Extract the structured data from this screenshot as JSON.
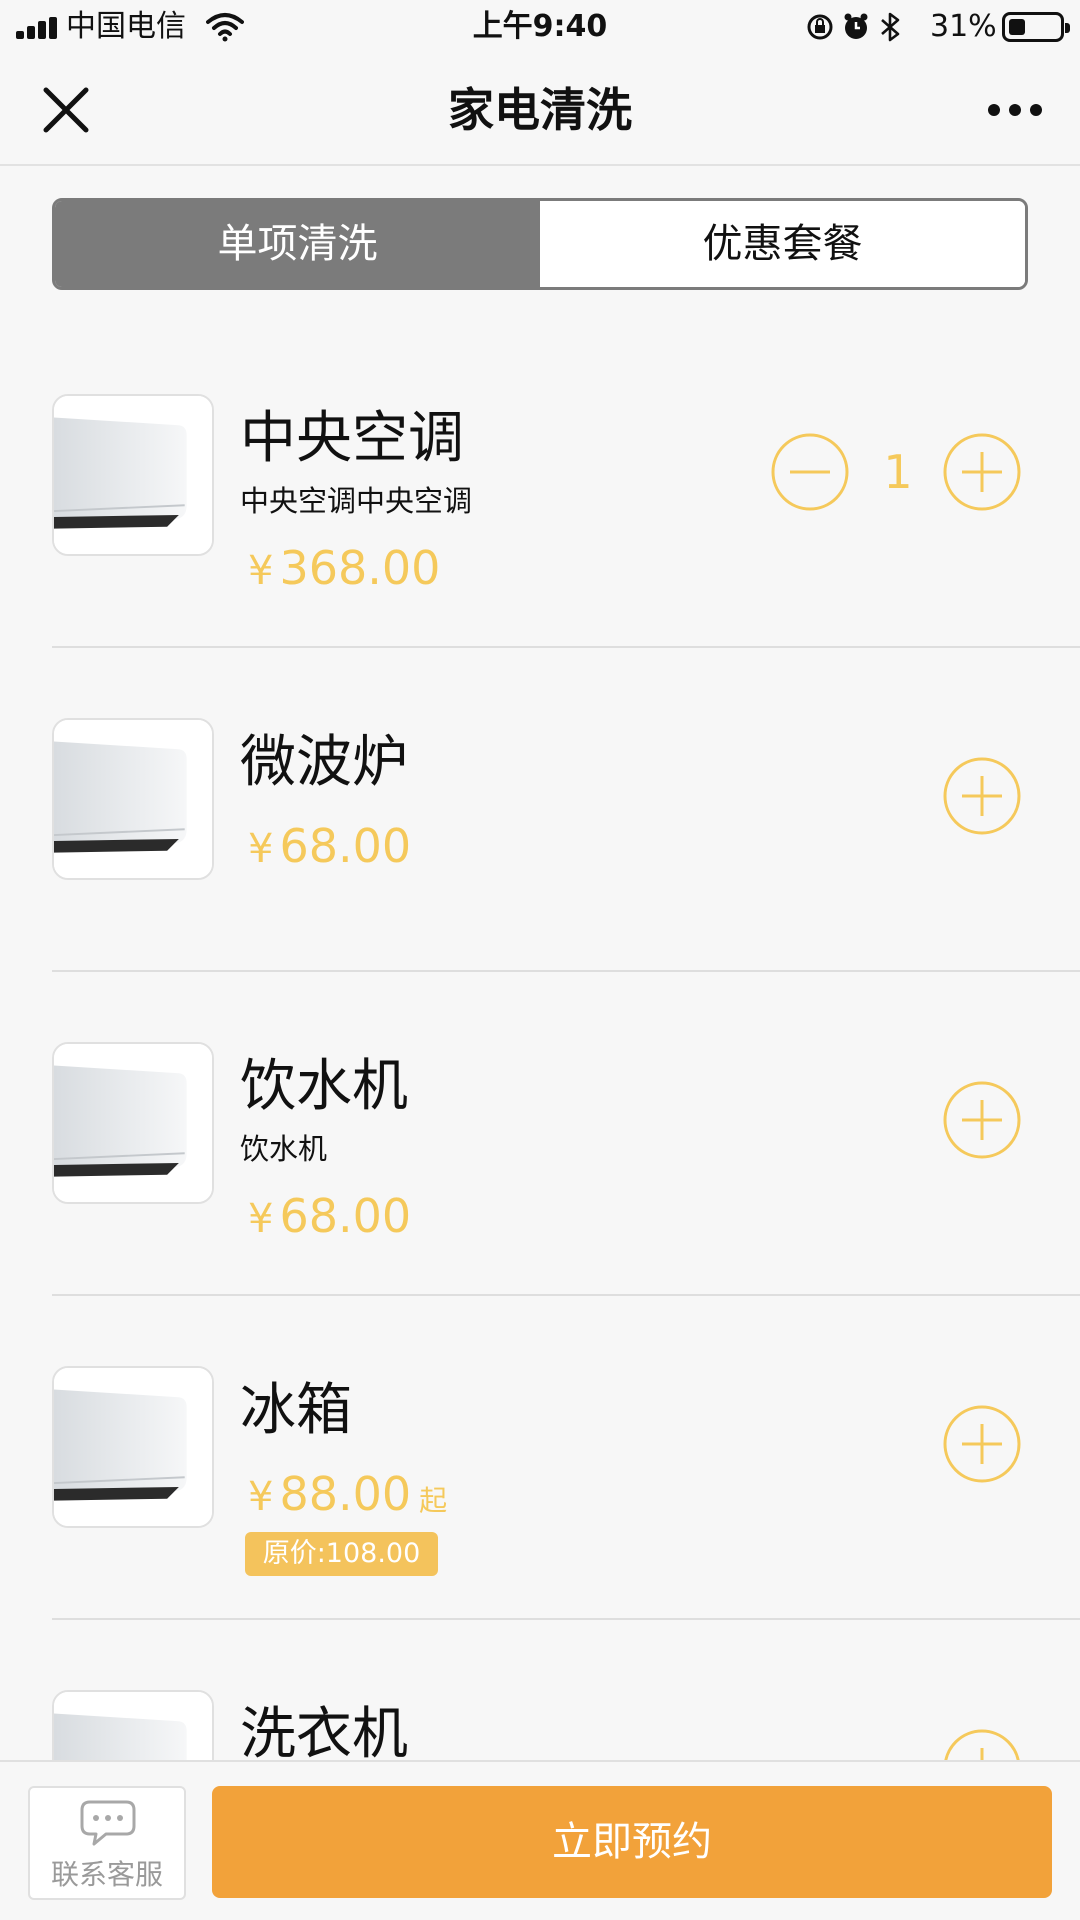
{
  "status_bar": {
    "carrier": "中国电信",
    "time": "上午9:40",
    "battery_percent": "31%",
    "battery_level": 0.31
  },
  "nav": {
    "title": "家电清洗",
    "close_icon": "close-icon",
    "more_icon": "more-icon"
  },
  "tabs": [
    {
      "label": "单项清洗",
      "active": true
    },
    {
      "label": "优惠套餐",
      "active": false
    }
  ],
  "items": [
    {
      "name": "中央空调",
      "desc": "中央空调中央空调",
      "currency": "¥",
      "price": "368.00",
      "quantity": "1"
    },
    {
      "name": "微波炉",
      "currency": "¥",
      "price": "68.00"
    },
    {
      "name": "饮水机",
      "desc": "饮水机",
      "currency": "¥",
      "price": "68.00"
    },
    {
      "name": "冰箱",
      "currency": "¥",
      "price": "88.00",
      "price_suffix": "起",
      "original_price": "原价:108.00"
    },
    {
      "name": "洗衣机"
    }
  ],
  "bottom": {
    "service_label": "联系客服",
    "book_label": "立即预约"
  },
  "colors": {
    "accent": "#f5c95b",
    "book_button": "#f2a23a",
    "tab_active": "#7b7b7b",
    "badge": "#f4c35c"
  }
}
